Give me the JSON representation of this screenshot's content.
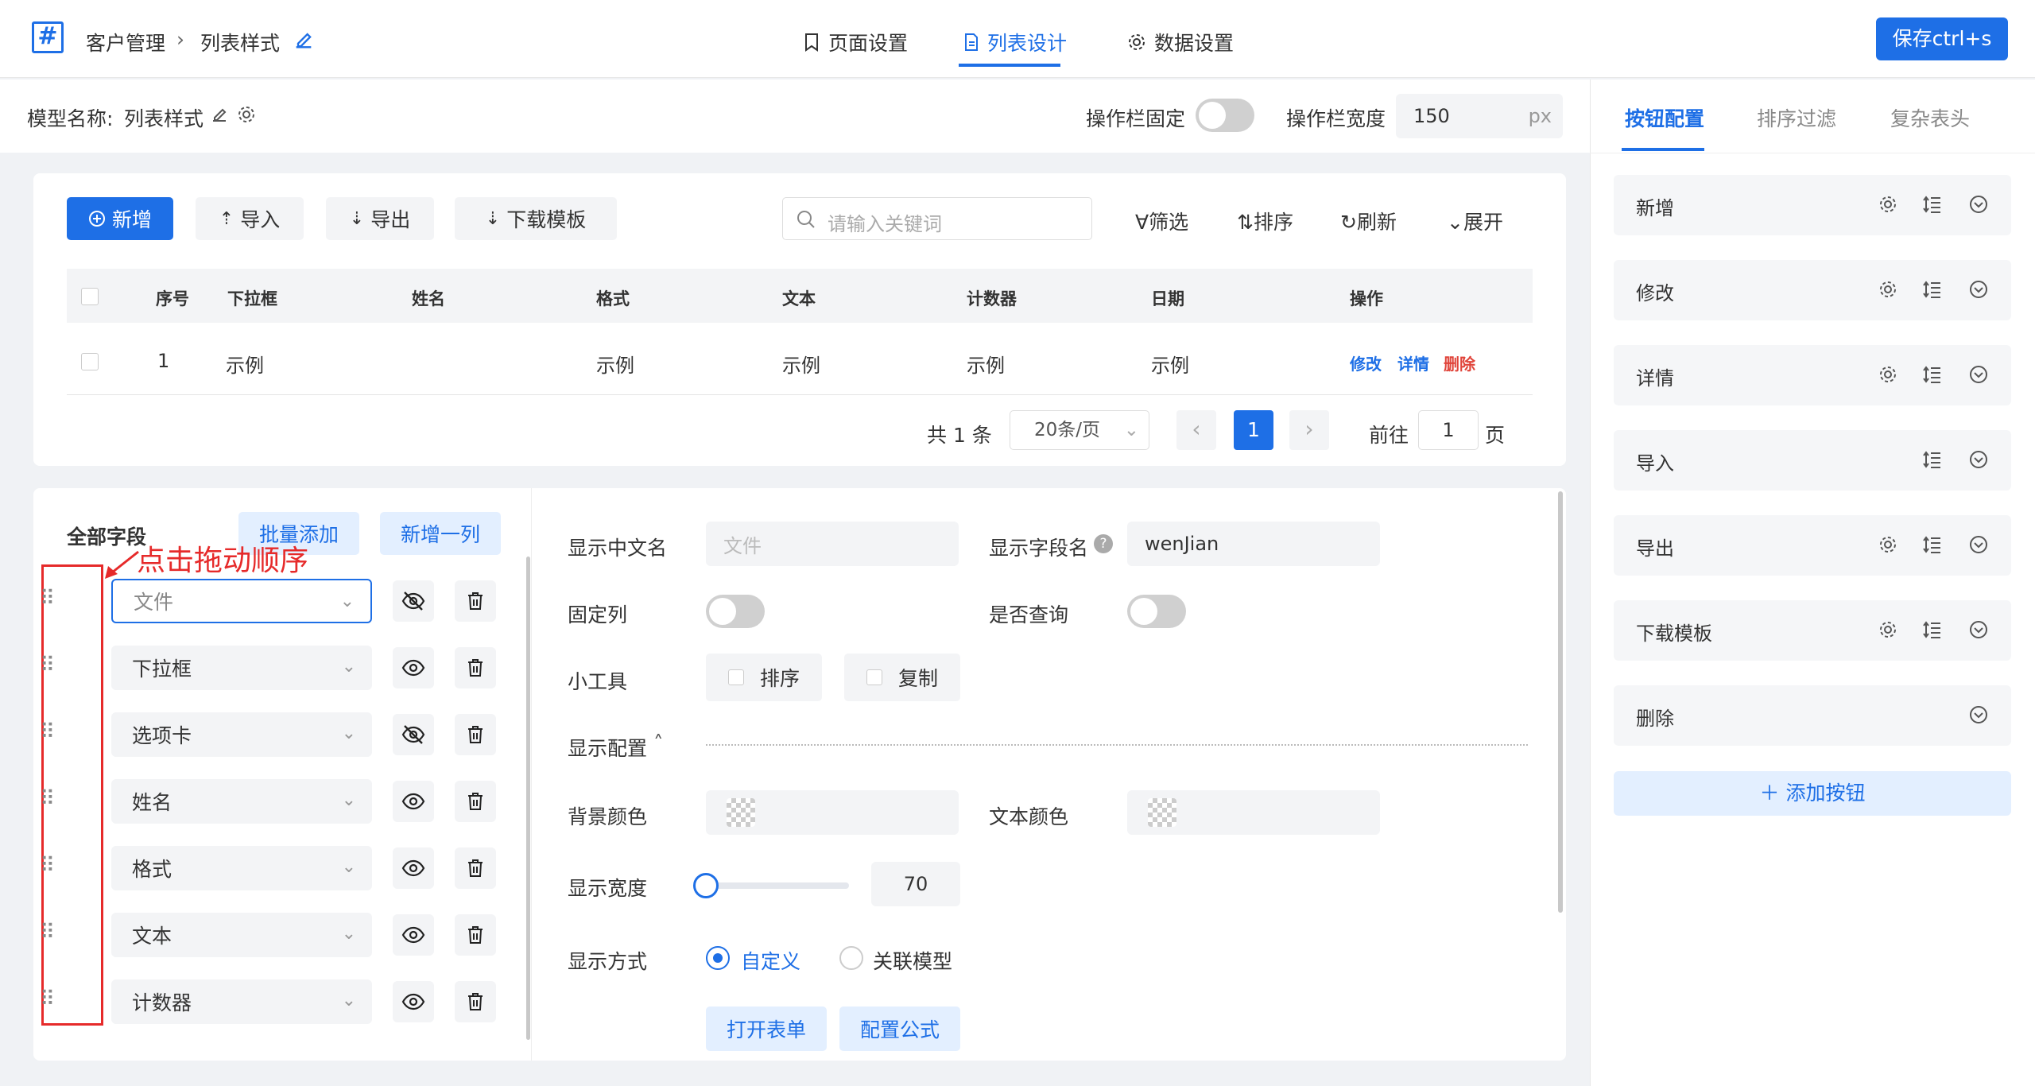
{
  "header": {
    "breadcrumb": [
      "客户管理",
      "列表样式"
    ],
    "tabs": [
      {
        "label": "页面设置",
        "icon": "bookmark-icon"
      },
      {
        "label": "列表设计",
        "icon": "document-icon",
        "active": true
      },
      {
        "label": "数据设置",
        "icon": "gear-icon"
      }
    ],
    "save_label": "保存ctrl+s"
  },
  "model_bar": {
    "model_label": "模型名称:",
    "model_name": "列表样式",
    "fixed_label": "操作栏固定",
    "fixed_on": false,
    "width_label": "操作栏宽度",
    "width_value": "150",
    "width_unit": "px"
  },
  "preview": {
    "buttons": {
      "add": "新增",
      "import": "导入",
      "export": "导出",
      "download": "下载模板"
    },
    "search_placeholder": "请输入关键词",
    "tools": {
      "filter": "筛选",
      "sort": "排序",
      "refresh": "刷新",
      "expand": "展开"
    },
    "columns": [
      "序号",
      "下拉框",
      "姓名",
      "格式",
      "文本",
      "计数器",
      "日期",
      "操作"
    ],
    "row": {
      "index": "1",
      "dropdown": "示例",
      "name": "",
      "format": "示例",
      "text": "示例",
      "counter": "示例",
      "date": "示例"
    },
    "row_actions": {
      "edit": "修改",
      "detail": "详情",
      "delete": "删除"
    },
    "pagination": {
      "total": "共 1 条",
      "page_size": "20条/页",
      "current": "1",
      "goto_label": "前往",
      "goto_value": "1",
      "goto_suffix": "页"
    }
  },
  "fields_panel": {
    "title": "全部字段",
    "batch_add": "批量添加",
    "add_column": "新增一列",
    "annotation": "点击拖动顺序",
    "fields": [
      {
        "name": "文件",
        "visible": false
      },
      {
        "name": "下拉框",
        "visible": true
      },
      {
        "name": "选项卡",
        "visible": false
      },
      {
        "name": "姓名",
        "visible": true
      },
      {
        "name": "格式",
        "visible": true
      },
      {
        "name": "文本",
        "visible": true
      },
      {
        "name": "计数器",
        "visible": true
      }
    ]
  },
  "field_config": {
    "display_name_label": "显示中文名",
    "display_name_placeholder": "文件",
    "field_name_label": "显示字段名",
    "field_name_value": "wenJian",
    "fixed_col_label": "固定列",
    "query_label": "是否查询",
    "tools_label": "小工具",
    "tool_sort": "排序",
    "tool_copy": "复制",
    "display_config_label": "显示配置",
    "bg_color_label": "背景颜色",
    "text_color_label": "文本颜色",
    "width_label": "显示宽度",
    "width_value": "70",
    "width_fraction": 0,
    "mode_label": "显示方式",
    "mode_custom": "自定义",
    "mode_linked": "关联模型",
    "open_form": "打开表单",
    "config_formula": "配置公式"
  },
  "right_panel": {
    "tabs": [
      "按钮配置",
      "排序过滤",
      "复杂表头"
    ],
    "items": [
      {
        "label": "新增",
        "gear": true
      },
      {
        "label": "修改",
        "gear": true
      },
      {
        "label": "详情",
        "gear": true
      },
      {
        "label": "导入",
        "gear": false
      },
      {
        "label": "导出",
        "gear": true
      },
      {
        "label": "下载模板",
        "gear": true
      },
      {
        "label": "删除",
        "gear": false,
        "list": false
      }
    ],
    "add_button": "添加按钮"
  },
  "colors": {
    "primary": "#1e6fe6",
    "danger": "#e0443a",
    "annotation": "#e62a2a"
  }
}
